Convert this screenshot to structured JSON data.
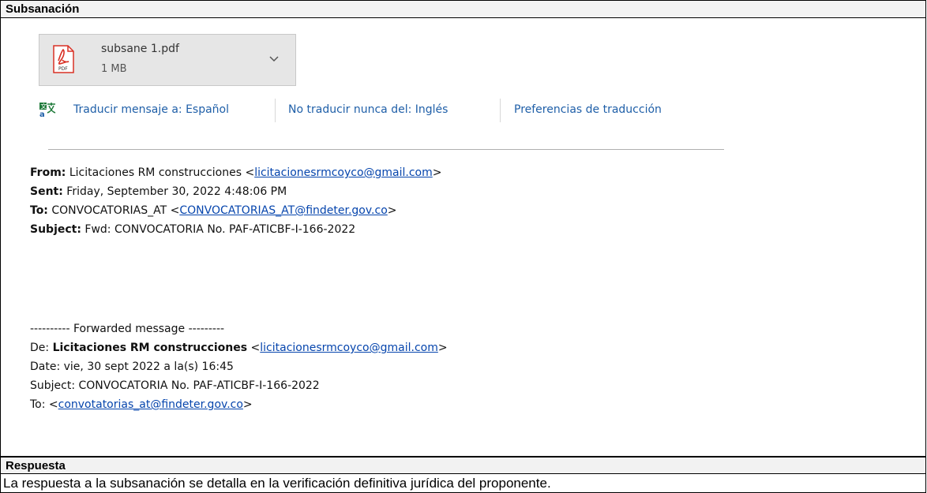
{
  "sections": {
    "subsanacion_title": "Subsanación",
    "respuesta_title": "Respuesta",
    "respuesta_text": "La respuesta a la subsanación se detalla en la verificación definitiva jurídica del proponente."
  },
  "attachment": {
    "name": "subsane 1.pdf",
    "size": "1 MB",
    "icon": "pdf-icon",
    "icon_label": "PDF"
  },
  "translate": {
    "translate_to": "Traducir mensaje a: Español",
    "never_translate": "No traducir nunca del: Inglés",
    "preferences": "Preferencias de traducción"
  },
  "email": {
    "from_label": "From:",
    "from_name": "Licitaciones RM construcciones <",
    "from_email": "licitacionesrmcoyco@gmail.com",
    "close": ">",
    "sent_label": "Sent:",
    "sent_value": "Friday, September 30, 2022 4:48:06 PM",
    "to_label": "To:",
    "to_name": "CONVOCATORIAS_AT <",
    "to_email": "CONVOCATORIAS_AT@findeter.gov.co",
    "subject_label": "Subject:",
    "subject_value": "Fwd: CONVOCATORIA No. PAF-ATICBF-I-166-2022"
  },
  "forwarded": {
    "header": "---------- Forwarded message ---------",
    "de_label": "De: ",
    "de_name": "Licitaciones RM construcciones",
    "de_open": " <",
    "de_email": "licitacionesrmcoyco@gmail.com",
    "date_line": "Date: vie, 30 sept 2022 a la(s) 16:45",
    "subject_line": "Subject: CONVOCATORIA No. PAF-ATICBF-I-166-2022",
    "to_label": "To: <",
    "to_email": "convotatorias_at@findeter.gov.co"
  },
  "colors": {
    "link": "#0645ad",
    "translate_link": "#1f5fa8",
    "pdf_red": "#d93025"
  }
}
